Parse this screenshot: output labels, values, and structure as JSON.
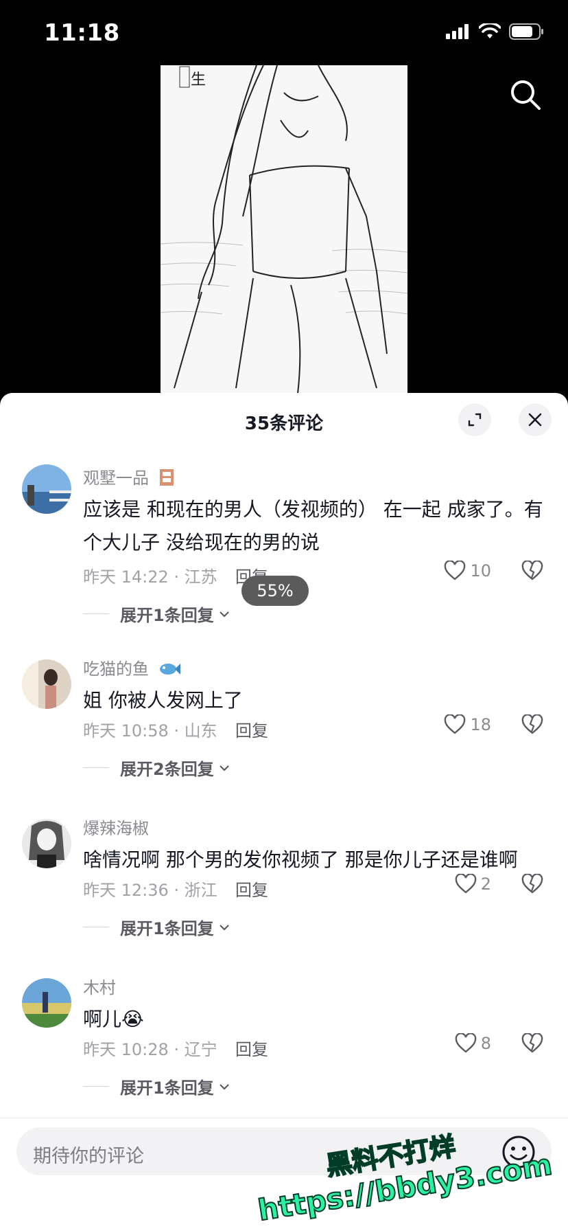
{
  "status_bar": {
    "time": "11:18"
  },
  "video": {
    "overlay_text": "生"
  },
  "sheet": {
    "title": "35条评论"
  },
  "progress_badge": "55%",
  "comments": [
    {
      "username": "观墅一品",
      "text": "应该是 和现在的男人（发视频的） 在一起 成家了。有个大儿子 没给现在的男的说",
      "time": "昨天 14:22 · 江苏",
      "reply_label": "回复",
      "likes": "10",
      "expand": "展开1条回复"
    },
    {
      "username": "吃猫的鱼",
      "text": "姐 你被人发网上了",
      "time": "昨天 10:58 · 山东",
      "reply_label": "回复",
      "likes": "18",
      "expand": "展开2条回复"
    },
    {
      "username": "爆辣海椒",
      "text": "啥情况啊 那个男的发你视频了 那是你儿子还是谁啊",
      "time": "昨天 12:36 · 浙江",
      "reply_label": "回复",
      "likes": "2",
      "expand": "展开1条回复"
    },
    {
      "username": "木村",
      "text": "啊儿😭",
      "time": "昨天 10:28 · 辽宁",
      "reply_label": "回复",
      "likes": "8",
      "expand": "展开1条回复"
    }
  ],
  "input": {
    "placeholder": "期待你的评论"
  },
  "watermark": {
    "line1": "黑料不打烊",
    "line2": "https://bbdy3.com"
  }
}
